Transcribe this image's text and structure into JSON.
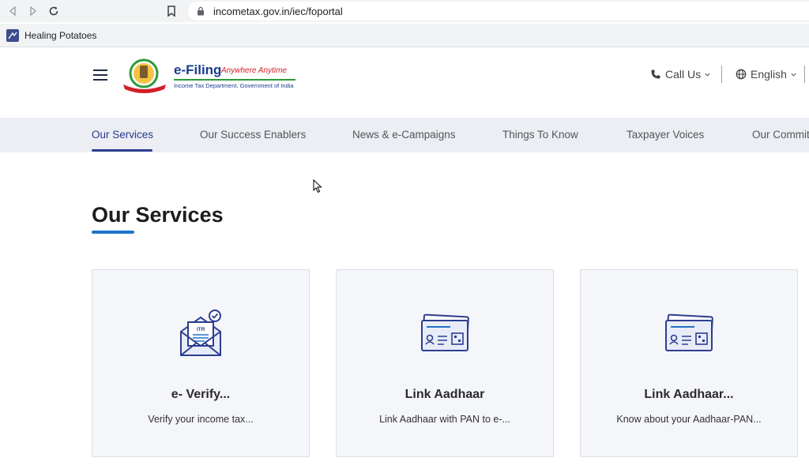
{
  "browser": {
    "url": "incometax.gov.in/iec/foportal",
    "bookmark_label": "Healing Potatoes"
  },
  "header": {
    "logo_title": "e-Filing",
    "logo_tagline": "Anywhere Anytime",
    "logo_subtitle": "Income Tax Department, Government of India",
    "call_us": "Call Us",
    "language": "English"
  },
  "tabs": [
    {
      "label": "Our Services"
    },
    {
      "label": "Our Success Enablers"
    },
    {
      "label": "News & e-Campaigns"
    },
    {
      "label": "Things To Know"
    },
    {
      "label": "Taxpayer Voices"
    },
    {
      "label": "Our Commitment"
    }
  ],
  "section": {
    "title": "Our Services"
  },
  "cards": [
    {
      "title": "e- Verify...",
      "desc": "Verify your income tax...",
      "icon": "envelope-itr-icon"
    },
    {
      "title": "Link Aadhaar",
      "desc": "Link Aadhaar with PAN to e-...",
      "icon": "id-card-icon"
    },
    {
      "title": "Link Aadhaar...",
      "desc": "Know about your Aadhaar-PAN...",
      "icon": "id-card-icon"
    }
  ],
  "colors": {
    "brand_blue": "#2d3e8f",
    "accent_blue": "#1f73c8",
    "tab_bg": "#eceef4",
    "card_bg": "#f5f6fa"
  }
}
